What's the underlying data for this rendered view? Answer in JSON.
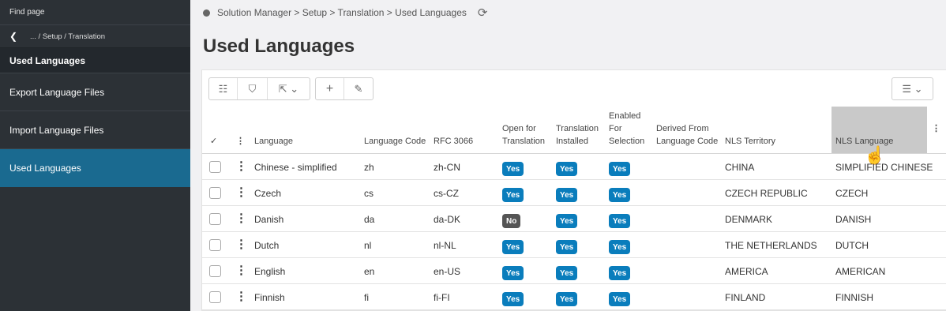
{
  "sidebar": {
    "find_page": "Find page",
    "back_path": "... / Setup / Translation",
    "title": "Used Languages",
    "items": [
      {
        "label": "Export Language Files"
      },
      {
        "label": "Import Language Files"
      },
      {
        "label": "Used Languages"
      }
    ]
  },
  "breadcrumb": {
    "text": "Solution Manager > Setup > Translation > Used Languages"
  },
  "page_title": "Used Languages",
  "columns": {
    "select": "✓",
    "language": "Language",
    "code": "Language Code",
    "rfc": "RFC 3066",
    "open1": "Open for",
    "open2": "Translation",
    "inst1": "Translation",
    "inst2": "Installed",
    "en1": "Enabled",
    "en2": "For",
    "en3": "Selection",
    "der1": "Derived From",
    "der2": "Language Code",
    "territory": "NLS Territory",
    "nlslang": "NLS Language"
  },
  "rows": [
    {
      "language": "Chinese - simplified",
      "code": "zh",
      "rfc": "zh-CN",
      "open": "Yes",
      "installed": "Yes",
      "enabled": "Yes",
      "derived": "",
      "territory": "CHINA",
      "nls": "SIMPLIFIED CHINESE"
    },
    {
      "language": "Czech",
      "code": "cs",
      "rfc": "cs-CZ",
      "open": "Yes",
      "installed": "Yes",
      "enabled": "Yes",
      "derived": "",
      "territory": "CZECH REPUBLIC",
      "nls": "CZECH"
    },
    {
      "language": "Danish",
      "code": "da",
      "rfc": "da-DK",
      "open": "No",
      "installed": "Yes",
      "enabled": "Yes",
      "derived": "",
      "territory": "DENMARK",
      "nls": "DANISH"
    },
    {
      "language": "Dutch",
      "code": "nl",
      "rfc": "nl-NL",
      "open": "Yes",
      "installed": "Yes",
      "enabled": "Yes",
      "derived": "",
      "territory": "THE NETHERLANDS",
      "nls": "DUTCH"
    },
    {
      "language": "English",
      "code": "en",
      "rfc": "en-US",
      "open": "Yes",
      "installed": "Yes",
      "enabled": "Yes",
      "derived": "",
      "territory": "AMERICA",
      "nls": "AMERICAN"
    },
    {
      "language": "Finnish",
      "code": "fi",
      "rfc": "fi-FI",
      "open": "Yes",
      "installed": "Yes",
      "enabled": "Yes",
      "derived": "",
      "territory": "FINLAND",
      "nls": "FINNISH"
    }
  ],
  "colors": {
    "sidebar_bg": "#2c3136",
    "active": "#1a6a90",
    "badge_yes": "#0a7dbc",
    "badge_no": "#555555"
  }
}
